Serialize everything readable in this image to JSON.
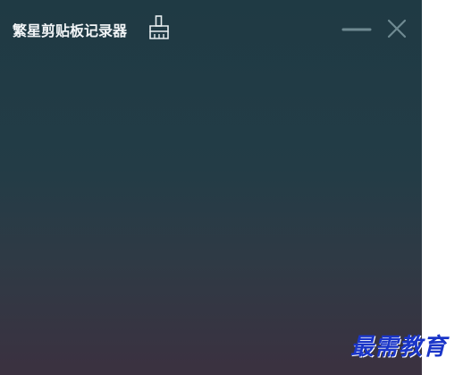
{
  "app": {
    "title": "繁星剪贴板记录器"
  },
  "icons": {
    "clear": "broom-icon",
    "minimize": "minimize-icon",
    "close": "close-icon"
  },
  "colors": {
    "gradient_top": "#1f3a44",
    "gradient_bottom": "#3b3140",
    "icon_color": "#6f8a92",
    "title_color": "#f2f5f7"
  },
  "watermark": {
    "text": "最需教育"
  }
}
